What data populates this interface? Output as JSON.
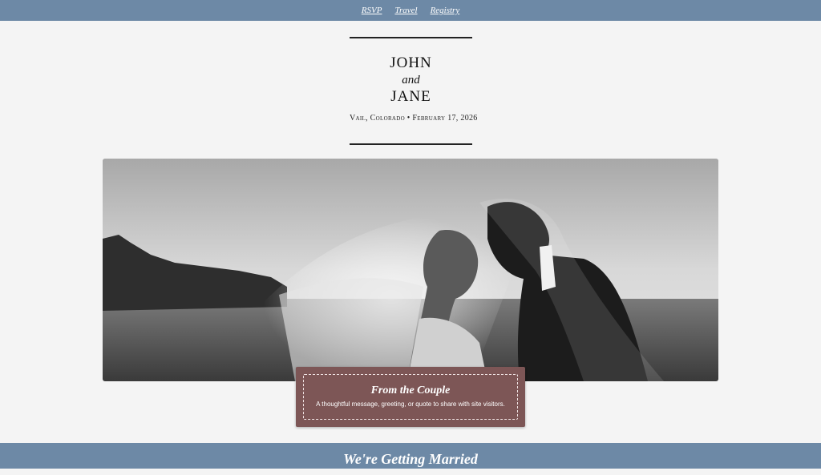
{
  "nav": {
    "items": [
      {
        "label": "RSVP"
      },
      {
        "label": "Travel"
      },
      {
        "label": "Registry"
      }
    ]
  },
  "header": {
    "name_one": "JOHN",
    "conjunction": "and",
    "name_two": "JANE",
    "location_date": "Vail, Colorado • February 17, 2026"
  },
  "hero": {
    "image": "black-and-white wedding photo of couple kissing under veil on a beach"
  },
  "couple_card": {
    "title": "From the Couple",
    "message": "A thoughtful message, greeting, or quote to share with site visitors."
  },
  "section": {
    "heading": "We're Getting Married"
  },
  "colors": {
    "nav_bg": "#6d89a6",
    "card_bg": "#7d5656",
    "page_bg": "#f4f4f4"
  }
}
